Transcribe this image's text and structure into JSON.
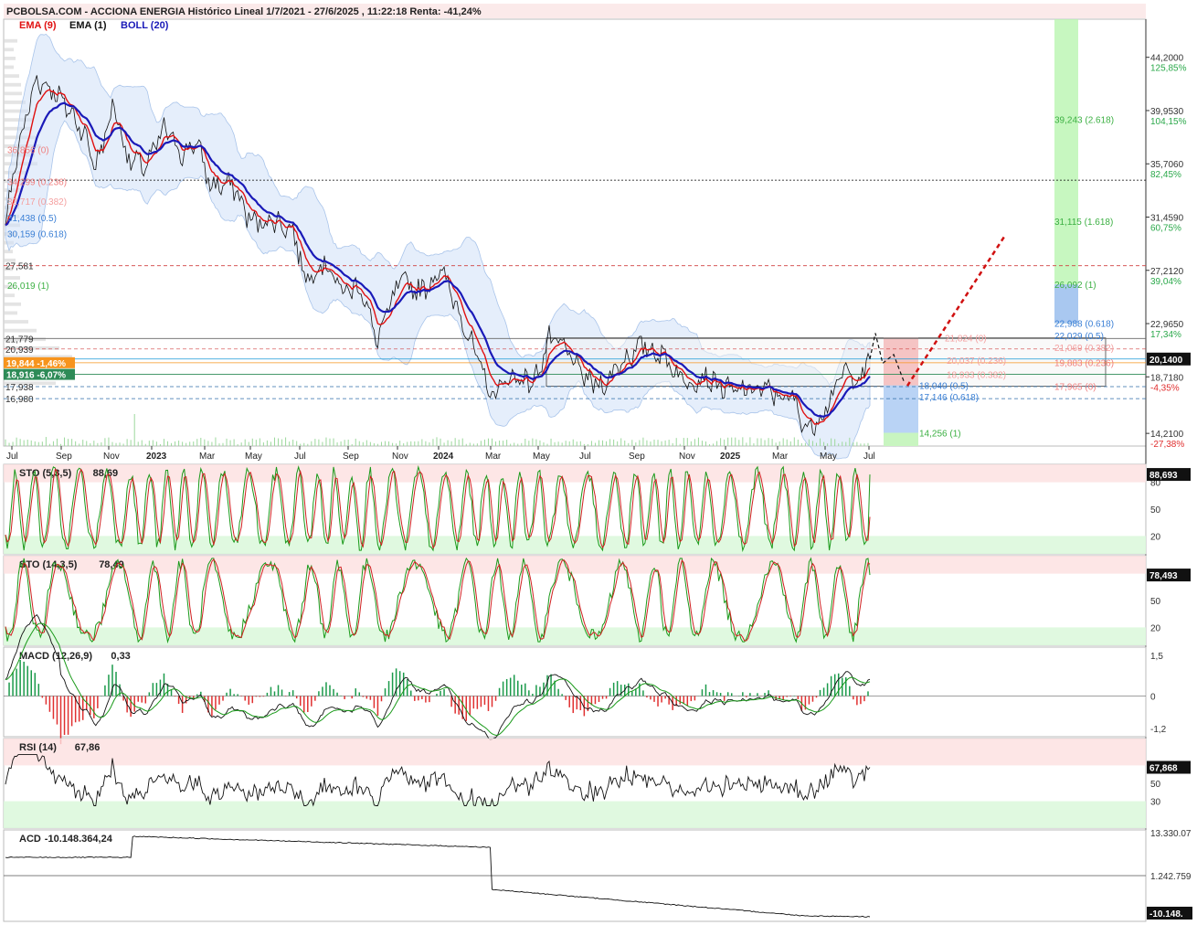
{
  "header": {
    "title": "PCBOLSA.COM - ACCIONA ENERGIA Histórico Lineal 1/7/2021 - 27/6/2025 , 11:22:18 Renta: -41,24%",
    "legend": [
      {
        "label": "EMA (9)",
        "color": "#e01010"
      },
      {
        "label": "EMA (1)",
        "color": "#111111"
      },
      {
        "label": "BOLL (20)",
        "color": "#1a1ab8"
      }
    ]
  },
  "chart_data": {
    "type": "line",
    "x_months": [
      "Jul",
      "Sep",
      "Nov",
      "2023",
      "Mar",
      "May",
      "Jul",
      "Sep",
      "Nov",
      "2024",
      "Mar",
      "May",
      "Jul",
      "Sep",
      "Nov",
      "2025",
      "Mar",
      "May",
      "Jul"
    ],
    "price_axis": {
      "ticks": [
        {
          "value": "44,2000",
          "pct": "125,85%"
        },
        {
          "value": "39,9530",
          "pct": "104,15%"
        },
        {
          "value": "35,7060",
          "pct": "82,45%"
        },
        {
          "value": "31,4590",
          "pct": "60,75%"
        },
        {
          "value": "27,2120",
          "pct": "39,04%"
        },
        {
          "value": "22,9650",
          "pct": "17,34%"
        },
        {
          "value": "18,7180",
          "pct": "-4,35%"
        },
        {
          "value": "14,2100",
          "pct": "-27,38%"
        }
      ],
      "last_price": "20,1400",
      "ylim": [
        13.2,
        46.0
      ]
    },
    "left_labels": [
      {
        "text": "27,581",
        "value": 27.581
      },
      {
        "text": "21,779",
        "value": 21.779
      },
      {
        "text": "20,939",
        "value": 20.939
      },
      {
        "text": "17,938",
        "value": 17.938
      },
      {
        "text": "16,980",
        "value": 16.98
      }
    ],
    "left_badges": [
      {
        "text": "19,844 -1,46%",
        "value": 19.844,
        "color": "#f7941d"
      },
      {
        "text": "18,916 -6,07%",
        "value": 18.916,
        "color": "#2e8b57"
      }
    ],
    "fib_left": [
      {
        "text": "36,856 (0)",
        "value": 36.856,
        "color": "#f08080"
      },
      {
        "text": "34,299 (0.236)",
        "value": 34.299,
        "color": "#f08080"
      },
      {
        "text": "32,717 (0.382)",
        "value": 32.717,
        "color": "#f4a0a0"
      },
      {
        "text": "31,438 (0.5)",
        "value": 31.438,
        "color": "#3a7fd5"
      },
      {
        "text": "30,159 (0.618)",
        "value": 30.159,
        "color": "#3a7fd5"
      },
      {
        "text": "26,019 (1)",
        "value": 26.019,
        "color": "#3cb043"
      }
    ],
    "fib_right_up": [
      {
        "text": "39,243 (2.618)",
        "value": 39.243,
        "color": "#3cb043"
      },
      {
        "text": "31,115 (1.618)",
        "value": 31.115,
        "color": "#3cb043"
      },
      {
        "text": "26,092 (1)",
        "value": 26.092,
        "color": "#3cb043"
      },
      {
        "text": "22,988 (0.618)",
        "value": 22.988,
        "color": "#3a7fd5"
      },
      {
        "text": "22,029 (0.5)",
        "value": 22.029,
        "color": "#3a7fd5"
      },
      {
        "text": "18,040 (0.5)",
        "value": 18.04,
        "color": "#3a7fd5"
      },
      {
        "text": "17,146 (0.618)",
        "value": 17.146,
        "color": "#3a7fd5"
      },
      {
        "text": "14,256 (1)",
        "value": 14.256,
        "color": "#3cb043"
      }
    ],
    "fib_right_down": [
      {
        "text": "21,824 (0)",
        "value": 21.824,
        "color": "#f4a0a0"
      },
      {
        "text": "21,069 (0.382)",
        "value": 21.069,
        "color": "#f4a0a0"
      },
      {
        "text": "20,037 (0.236)",
        "value": 20.037,
        "color": "#f4a0a0"
      },
      {
        "text": "19,883 (0.236)",
        "value": 19.883,
        "color": "#f08080"
      },
      {
        "text": "18,933 (0.382)",
        "value": 18.933,
        "color": "#f4a0a0"
      },
      {
        "text": "17,965 (0)",
        "value": 17.965,
        "color": "#f08080"
      }
    ],
    "panels": [
      {
        "id": "sto1",
        "label": "STO (5,3,5)",
        "value": "88,69",
        "last": "88,693",
        "levels": [
          "80",
          "50",
          "20"
        ]
      },
      {
        "id": "sto2",
        "label": "STO (14,3,5)",
        "value": "78,49",
        "last": "78,493",
        "levels": [
          "80",
          "50",
          "20"
        ]
      },
      {
        "id": "macd",
        "label": "MACD (12,26,9)",
        "value": "0,33",
        "levels": [
          "1,5",
          "0",
          "-1,2"
        ]
      },
      {
        "id": "rsi",
        "label": "RSI (14)",
        "value": "67,86",
        "last": "67,868",
        "levels": [
          "70",
          "50",
          "30"
        ]
      },
      {
        "id": "acd",
        "label": "ACD",
        "value": "-10.148.364,24",
        "last": "-10.148.",
        "levels": [
          "13.330.07",
          "1.242.759"
        ]
      }
    ]
  }
}
